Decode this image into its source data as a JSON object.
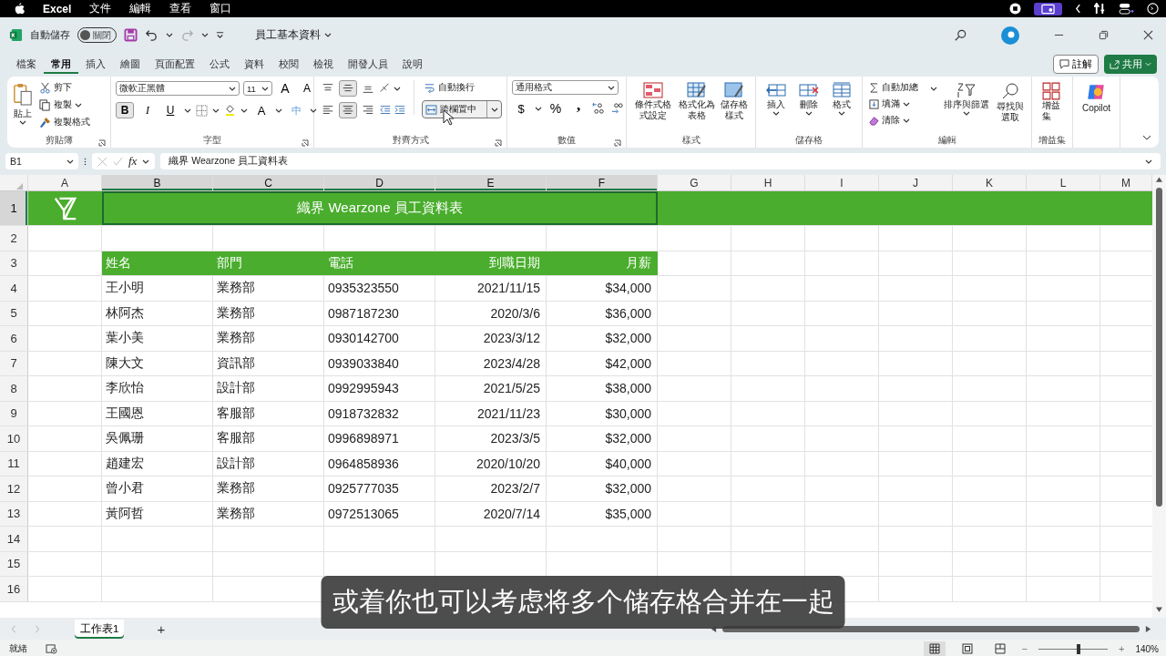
{
  "menubar": {
    "app": "Excel",
    "items": [
      "文件",
      "編輯",
      "查看",
      "窗口"
    ]
  },
  "titlebar": {
    "autosave": "自動儲存",
    "autosave_switch": {
      "label": "關閉",
      "on": false
    },
    "document": "員工基本資料"
  },
  "ribbon_tabs": [
    {
      "label": "檔案",
      "selected": false
    },
    {
      "label": "常用",
      "selected": true
    },
    {
      "label": "插入",
      "selected": false
    },
    {
      "label": "繪圖",
      "selected": false
    },
    {
      "label": "頁面配置",
      "selected": false
    },
    {
      "label": "公式",
      "selected": false
    },
    {
      "label": "資料",
      "selected": false
    },
    {
      "label": "校閱",
      "selected": false
    },
    {
      "label": "檢視",
      "selected": false
    },
    {
      "label": "開發人員",
      "selected": false
    },
    {
      "label": "說明",
      "selected": false
    }
  ],
  "comments_button": "註解",
  "share_button": "共用",
  "ribbon": {
    "clipboard": {
      "paste": "貼上",
      "cut": "剪下",
      "copy": "複製",
      "format_painter": "複製格式",
      "group": "剪貼簿"
    },
    "font": {
      "name": "微軟正黑體",
      "size": "11",
      "grow": "A",
      "shrink": "A",
      "bold": {
        "label": "B",
        "selected": true
      },
      "italic": "I",
      "underline": "U",
      "font_color": "A",
      "phonetic": "中",
      "group": "字型"
    },
    "alignment": {
      "vertical": [
        {
          "selected": false
        },
        {
          "selected": true
        },
        {
          "selected": false
        }
      ],
      "horizontal": [
        {
          "selected": false
        },
        {
          "selected": true
        },
        {
          "selected": false
        }
      ],
      "wrap": "自動換行",
      "merge": {
        "label": "跨欄置中",
        "hovered": true
      },
      "group": "對齊方式"
    },
    "number": {
      "format": "通用格式",
      "currency": "$",
      "percent": "%",
      "comma": ",",
      "group": "數值"
    },
    "styles": {
      "conditional": "條件式格式設定",
      "as_table": "格式化為表格",
      "cell_styles": "儲存格樣式",
      "group": "樣式"
    },
    "cells": {
      "insert": "插入",
      "delete": "刪除",
      "format": "格式",
      "group": "儲存格"
    },
    "editing": {
      "autosum": "自動加總",
      "fill": "填滿",
      "clear": "清除",
      "sort": "排序與篩選",
      "find": "尋找與選取",
      "group": "編輯"
    },
    "addins": {
      "button": "增益集",
      "group": "增益集"
    },
    "copilot": "Copilot"
  },
  "formula_bar": {
    "name_box": "B1",
    "function_label": "fx",
    "content": "織界 Wearzone 員工資料表"
  },
  "sheet": {
    "columns": [
      {
        "label": "A",
        "selected": false
      },
      {
        "label": "B",
        "selected": true
      },
      {
        "label": "C",
        "selected": true
      },
      {
        "label": "D",
        "selected": true
      },
      {
        "label": "E",
        "selected": true
      },
      {
        "label": "F",
        "selected": true
      },
      {
        "label": "G",
        "selected": false
      },
      {
        "label": "H",
        "selected": false
      },
      {
        "label": "I",
        "selected": false
      },
      {
        "label": "J",
        "selected": false
      },
      {
        "label": "K",
        "selected": false
      },
      {
        "label": "L",
        "selected": false
      },
      {
        "label": "M",
        "selected": false
      }
    ],
    "row_headers": [
      {
        "label": "1",
        "selected": true
      },
      {
        "label": "2",
        "selected": false
      },
      {
        "label": "3",
        "selected": false
      },
      {
        "label": "4",
        "selected": false
      },
      {
        "label": "5",
        "selected": false
      },
      {
        "label": "6",
        "selected": false
      },
      {
        "label": "7",
        "selected": false
      },
      {
        "label": "8",
        "selected": false
      },
      {
        "label": "9",
        "selected": false
      },
      {
        "label": "10",
        "selected": false
      },
      {
        "label": "11",
        "selected": false
      },
      {
        "label": "12",
        "selected": false
      },
      {
        "label": "13",
        "selected": false
      },
      {
        "label": "14",
        "selected": false
      },
      {
        "label": "15",
        "selected": false
      },
      {
        "label": "16",
        "selected": false
      }
    ],
    "title": "織界 Wearzone 員工資料表",
    "header": [
      "姓名",
      "部門",
      "電話",
      "到職日期",
      "月薪"
    ],
    "records": [
      [
        "王小明",
        "業務部",
        "0935323550",
        "2021/11/15",
        "$34,000"
      ],
      [
        "林阿杰",
        "業務部",
        "0987187230",
        "2020/3/6",
        "$36,000"
      ],
      [
        "葉小美",
        "業務部",
        "0930142700",
        "2023/3/12",
        "$32,000"
      ],
      [
        "陳大文",
        "資訊部",
        "0939033840",
        "2023/4/28",
        "$42,000"
      ],
      [
        "李欣怡",
        "設計部",
        "0992995943",
        "2021/5/25",
        "$38,000"
      ],
      [
        "王國恩",
        "客服部",
        "0918732832",
        "2021/11/23",
        "$30,000"
      ],
      [
        "吳佩珊",
        "客服部",
        "0996898971",
        "2023/3/5",
        "$32,000"
      ],
      [
        "趙建宏",
        "設計部",
        "0964858936",
        "2020/10/20",
        "$40,000"
      ],
      [
        "曾小君",
        "業務部",
        "0925777035",
        "2023/2/7",
        "$32,000"
      ],
      [
        "黃阿哲",
        "業務部",
        "0972513065",
        "2020/7/14",
        "$35,000"
      ]
    ]
  },
  "sheet_tabs": [
    {
      "label": "工作表1",
      "selected": true
    }
  ],
  "add_sheet": "+",
  "status_bar": {
    "ready": "就緒",
    "views": [
      {
        "selected": true
      },
      {
        "selected": false
      },
      {
        "selected": false
      }
    ],
    "zoom": {
      "minus": "−",
      "plus": "+",
      "level": 0.58,
      "reading": "140%"
    }
  },
  "subtitle": "或着你也可以考虑将多个储存格合并在一起"
}
